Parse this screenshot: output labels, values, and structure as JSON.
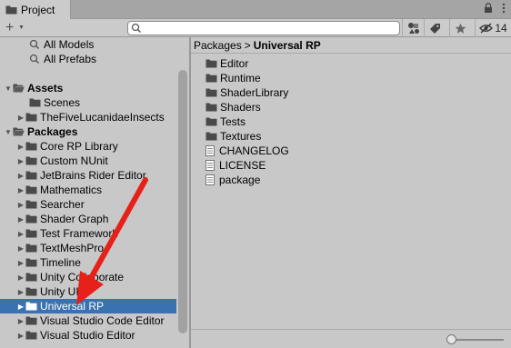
{
  "tab": {
    "title": "Project",
    "icon": "folder-icon"
  },
  "tab_controls": {
    "lock_icon": "lock-icon",
    "menu_icon": "kebab-menu-icon"
  },
  "toolbar": {
    "create_icon": "plus-icon",
    "search_placeholder": "",
    "search_value": "",
    "hidden_count": "14"
  },
  "sidebar": {
    "favorites": [
      {
        "label": "All Models"
      },
      {
        "label": "All Prefabs"
      }
    ],
    "assets": {
      "label": "Assets",
      "children": [
        {
          "label": "Scenes"
        },
        {
          "label": "TheFiveLucanidaeInsects"
        }
      ]
    },
    "packages": {
      "label": "Packages",
      "children": [
        {
          "label": "Core RP Library"
        },
        {
          "label": "Custom NUnit"
        },
        {
          "label": "JetBrains Rider Editor"
        },
        {
          "label": "Mathematics"
        },
        {
          "label": "Searcher"
        },
        {
          "label": "Shader Graph"
        },
        {
          "label": "Test Framework"
        },
        {
          "label": "TextMeshPro"
        },
        {
          "label": "Timeline"
        },
        {
          "label": "Unity Collaborate"
        },
        {
          "label": "Unity UI"
        },
        {
          "label": "Universal RP"
        },
        {
          "label": "Visual Studio Code Editor"
        },
        {
          "label": "Visual Studio Editor"
        }
      ]
    }
  },
  "breadcrumb": {
    "root": "Packages",
    "separator": ">",
    "current": "Universal RP"
  },
  "contents": [
    {
      "label": "Editor",
      "kind": "folder"
    },
    {
      "label": "Runtime",
      "kind": "folder"
    },
    {
      "label": "ShaderLibrary",
      "kind": "folder"
    },
    {
      "label": "Shaders",
      "kind": "folder"
    },
    {
      "label": "Tests",
      "kind": "folder"
    },
    {
      "label": "Textures",
      "kind": "folder"
    },
    {
      "label": "CHANGELOG",
      "kind": "file"
    },
    {
      "label": "LICENSE",
      "kind": "file"
    },
    {
      "label": "package",
      "kind": "file"
    }
  ],
  "colors": {
    "selection": "#3a72b0",
    "annotation_arrow": "#e8201a"
  }
}
